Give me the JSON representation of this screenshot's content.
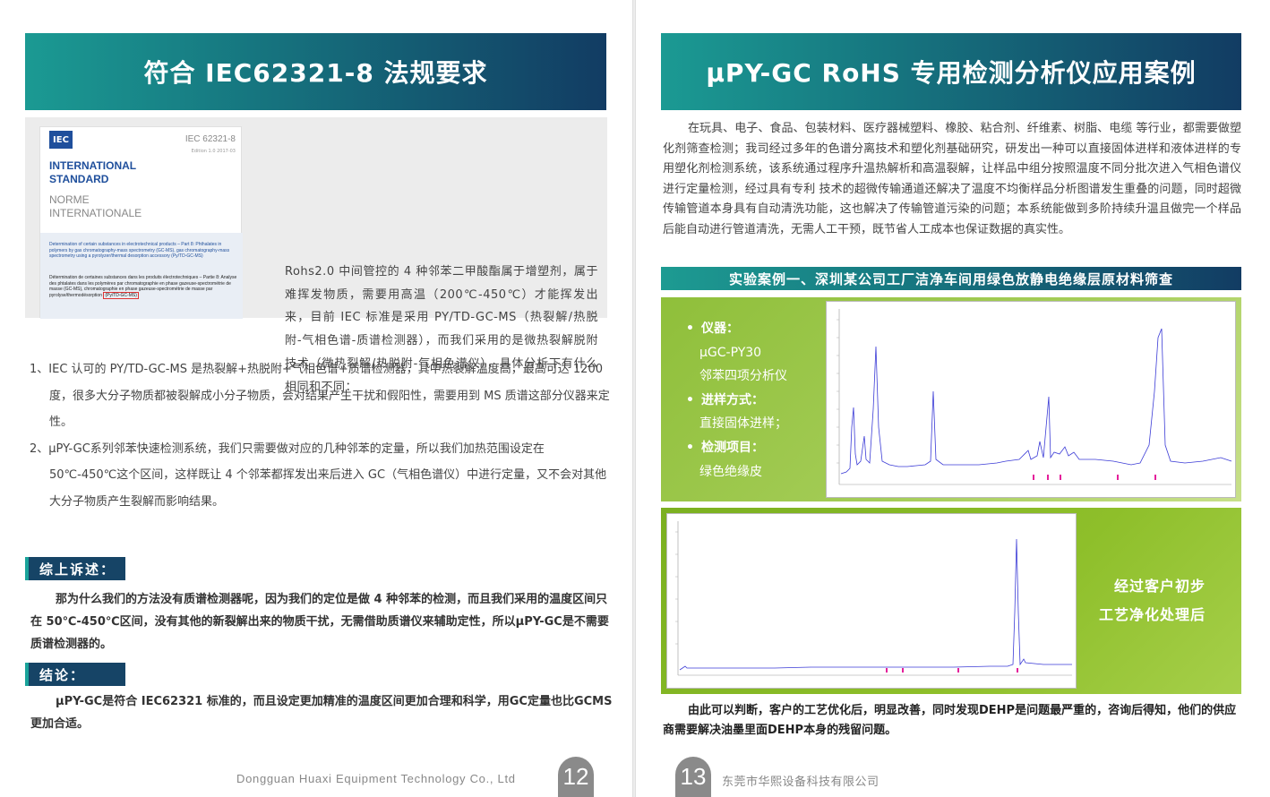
{
  "left": {
    "banner": "符合 IEC62321-8 法规要求",
    "iec_cover": {
      "logo": "IEC",
      "number": "IEC 62321-8",
      "edition": "Edition 1.0  2017-03",
      "line1": "INTERNATIONAL",
      "line2": "STANDARD",
      "line3": "NORME",
      "line4": "INTERNATIONALE",
      "en_text": "Determination of certain substances in electrotechnical products – Part 8: Phthalates in polymers by gas chromatography-mass spectrometry (GC-MS), gas chromatography-mass spectrometry using a pyrolyzer/thermal desorption accessory (Py/TD-GC-MS)",
      "fr_text": "Détermination de certaines substances dans les produits électrotechniques – Partie 8: Analyse des phtalates dans les polymères par chromatographie en phase gazeuse-spectrométrie de masse (GC-MS), chromatographie en phase gazeuse-spectrométrie de masse par pyrolyse/thermodésorption",
      "fr_highlight": "(Py/TD-GC-MS)"
    },
    "iec_desc": "Rohs2.0 中间管控的 4 种邻苯二甲酸酯属于增塑剂，属于难挥发物质，需要用高温（200℃-450℃）才能挥发出来，目前 IEC 标准是采用 PY/TD-GC-MS（热裂解/热脱附-气相色谱-质谱检测器），而我们采用的是微热裂解脱附技术（微热裂解/热脱附-气相色谱仪），具体分析下有什么相同和不同：",
    "item1": "1、IEC 认可的 PY/TD-GC-MS 是热裂解+热脱附+气相色谱+质谱检测器，其中热裂解温度高，最高可达 1200 度，很多大分子物质都被裂解成小分子物质，会对结果产生干扰和假阳性，需要用到 MS 质谱这部分仪器来定性。",
    "item2": "2、μPY-GC系列邻苯快速检测系统，我们只需要做对应的几种邻苯的定量，所以我们加热范围设定在 50℃-450℃这个区间，这样既让 4 个邻苯都挥发出来后进入 GC（气相色谱仪）中进行定量，又不会对其他大分子物质产生裂解而影响结果。",
    "summary_tag": "综上诉述：",
    "summary_text": "那为什么我们的方法没有质谱检测器呢，因为我们的定位是做 4 种邻苯的检测，而且我们采用的温度区间只在 50℃-450℃区间，没有其他的新裂解出来的物质干扰，无需借助质谱仪来辅助定性，所以μPY-GC是不需要质谱检测器的。",
    "conclusion_tag": "结论：",
    "conclusion_text": "μPY-GC是符合 IEC62321 标准的，而且设定更加精准的温度区间更加合理和科学，用GC定量也比GCMS更加合适。",
    "footer_company": "Dongguan Huaxi Equipment Technology Co., Ltd",
    "page_number": "12"
  },
  "right": {
    "banner": "μPY-GC RoHS 专用检测分析仪应用案例",
    "intro": "在玩具、电子、食品、包装材料、医疗器械塑料、橡胶、粘合剂、纤维素、树脂、电缆 等行业，都需要做塑化剂筛查检测；我司经过多年的色谱分离技术和塑化剂基础研究，研发出一种可以直接固体进样和液体进样的专用塑化剂检测系统，该系统通过程序升温热解析和高温裂解，让样品中组分按照温度不同分批次进入气相色谱仪进行定量检测，经过具有专利 技术的超微传输通道还解决了温度不均衡样品分析图谱发生重叠的问题，同时超微传输管道本身具有自动清洗功能，这也解决了传输管道污染的问题；本系统能做到多阶持续升温且做完一个样品后能自动进行管道清洗，无需人工干预，既节省人工成本也保证数据的真实性。",
    "case_title": "实验案例一、深圳某公司工厂洁净车间用绿色放静电绝缘层原材料筛查",
    "instrument_label": "仪器：",
    "instrument_line1": "μGC-PY30",
    "instrument_line2": "邻苯四项分析仪",
    "injection_label": "进样方式：",
    "injection_value": "直接固体进样；",
    "item_label": "检测项目：",
    "item_value": "绿色绝缘皮",
    "after_line1": "经过客户初步",
    "after_line2": "工艺净化处理后",
    "conclusion": "由此可以判断，客户的工艺优化后，明显改善，同时发现DEHP是问题最严重的，咨询后得知，他们的供应商需要解决油墨里面DEHP本身的残留问题。",
    "footer_company": "东莞市华熙设备科技有限公司",
    "page_number": "13"
  },
  "colors": {
    "banner_start": "#1b9a93",
    "banner_end": "#123c63",
    "tag_bg": "#164466",
    "green_panel": "#8fbf3a",
    "trace": "#3b3bd6"
  }
}
